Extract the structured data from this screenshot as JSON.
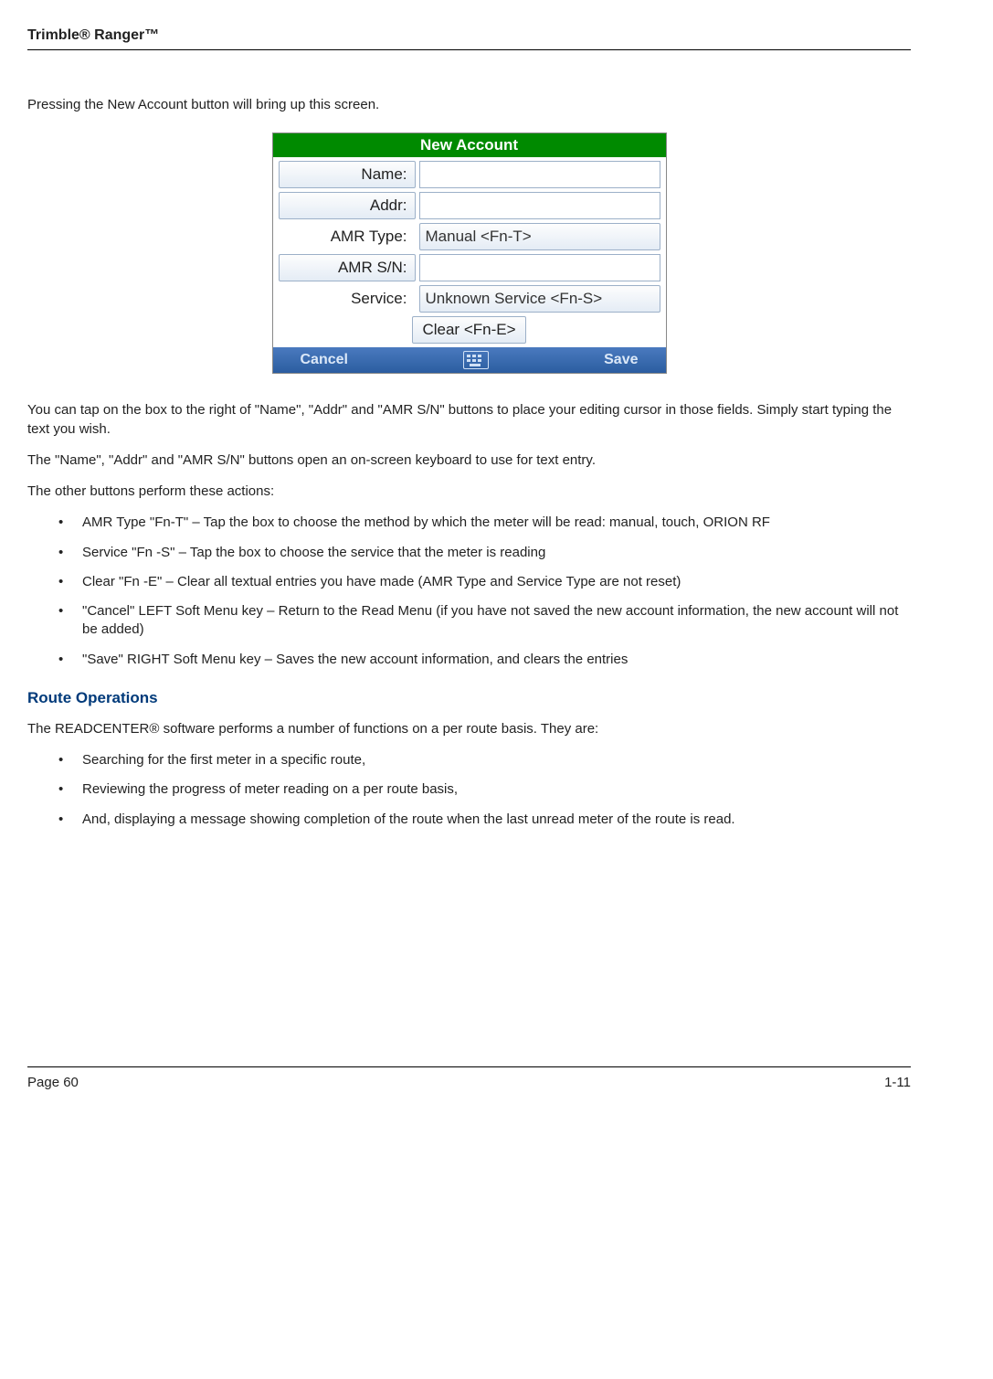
{
  "header": "Trimble® Ranger™",
  "intro": "Pressing the New Account button will bring up this screen.",
  "screenshot": {
    "title": "New Account",
    "rows": [
      {
        "kind": "btn-field",
        "label": "Name:",
        "value": ""
      },
      {
        "kind": "btn-field",
        "label": "Addr:",
        "value": ""
      },
      {
        "kind": "plain-btn",
        "label": "AMR Type:",
        "value": "Manual <Fn-T>"
      },
      {
        "kind": "btn-field",
        "label": "AMR S/N:",
        "value": ""
      },
      {
        "kind": "plain-btn",
        "label": "Service:",
        "value": "Unknown Service <Fn-S>"
      }
    ],
    "clear": "Clear <Fn-E>",
    "softkeys": {
      "left": "Cancel",
      "right": "Save"
    }
  },
  "para1": "You can tap on the box to the right of \"Name\", \"Addr\" and \"AMR S/N\" buttons to place your editing cursor in those fields.  Simply start typing the text you wish.",
  "para2": "The \"Name\", \"Addr\" and \"AMR S/N\" buttons open an on-screen keyboard to use for text entry.",
  "para3": "The other buttons perform these actions:",
  "actions": [
    "AMR Type \"Fn-T\" – Tap the box to choose the method by which the meter will be read:  manual, touch, ORION RF",
    "Service \"Fn -S\" – Tap the box to choose the service that the meter is reading",
    "Clear \"Fn -E\" – Clear all textual entries you have made (AMR Type and Service Type are not reset)",
    "\"Cancel\" LEFT Soft Menu key – Return to the Read Menu (if you have not saved the new account information, the new account will not be added)",
    "\"Save\" RIGHT Soft Menu key – Saves the new account information, and clears the entries"
  ],
  "section": "Route Operations",
  "para4": "The READCENTER® software performs a number of functions on a per route basis.  They are:",
  "routes": [
    "Searching for the first meter in a specific route,",
    "Reviewing the progress of meter reading on a per route basis,",
    "And, displaying a message showing completion of the route when the last unread meter of the route is read."
  ],
  "footer": {
    "left": "Page 60",
    "right": "1-11"
  }
}
